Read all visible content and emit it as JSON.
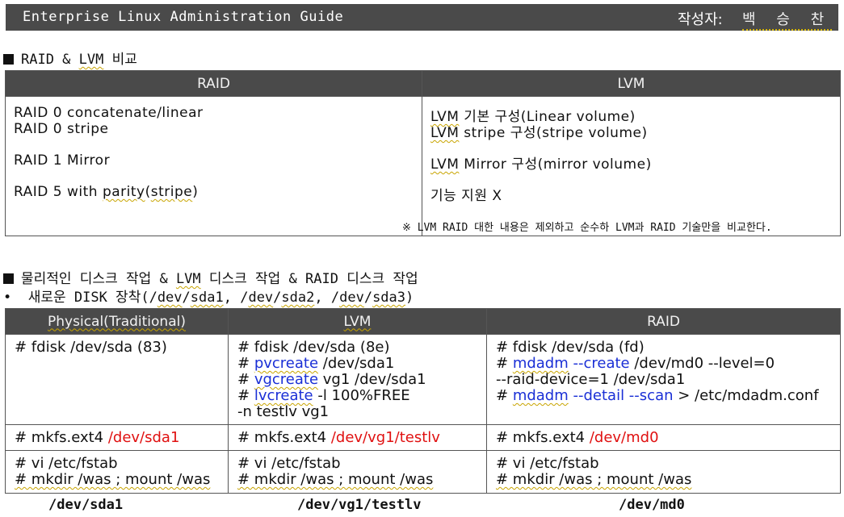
{
  "header": {
    "title": "Enterprise Linux Administration Guide",
    "author_label": "작성자:",
    "author_name": "백 승 찬"
  },
  "section1": {
    "title_pre": "RAID & ",
    "title_lvm": "LVM",
    "title_post": " 비교",
    "table": {
      "headers": [
        "RAID",
        "LVM"
      ],
      "raid": {
        "r0a": "RAID 0 concatenate/linear",
        "r0b": "RAID 0 stripe",
        "r1": "RAID 1 Mirror",
        "r5_pre": "RAID 5 with ",
        "r5_parity": "parity",
        "r5_paren_open": "(",
        "r5_stripe": "stripe",
        "r5_paren_close": ")"
      },
      "lvm": {
        "prefix": "LVM",
        "l1": " 기본 구성(Linear volume)",
        "l2": " stripe 구성(stripe volume)",
        "l3": " Mirror 구성(mirror volume)",
        "l4": "기능 지원 X"
      }
    },
    "note": "※ LVM RAID 대한 내용은 제외하고 순수하 LVM과 RAID 기술만을 비교한다."
  },
  "section2": {
    "title_pre": "물리적인 디스크 작업 & ",
    "title_lvm": "LVM",
    "title_post": " 디스크 작업 & RAID 디스크 작업",
    "bullet": {
      "pre": "새로운 DISK 장착(/",
      "dev1": "dev",
      "sda1": "sda1",
      "mid1": ", /",
      "dev2": "dev",
      "sda2": "sda2",
      "mid2": ", /",
      "dev3": "dev",
      "sda3": "sda3",
      "close": ")"
    },
    "table": {
      "headers": [
        "Physical(Traditional)",
        "LVM",
        "RAID"
      ],
      "row1": {
        "physical": "# fdisk /dev/sda (83)",
        "lvm": {
          "l1": "# fdisk /dev/sda (8e)",
          "l2_hash": "# ",
          "l2_cmd": "pvcreate",
          "l2_rest": " /dev/sda1",
          "l3_hash": "# ",
          "l3_cmd": "vgcreate",
          "l3_rest": " vg1 /dev/sda1",
          "l4_hash": "# ",
          "l4_cmd": "lvcreate",
          "l4_rest": " -l 100%FREE",
          "l5": "-n testlv vg1"
        },
        "raid": {
          "l1": "# fdisk /dev/sda (fd)",
          "l2_hash": "# ",
          "l2_cmd": "mdadm",
          "l2_opt": " --create",
          "l2_rest": " /dev/md0 --level=0",
          "l3": "--raid-device=1 /dev/sda1",
          "l4_hash": "# ",
          "l4_cmd": "mdadm",
          "l4_opt1": " --detail",
          "l4_opt2": " --scan",
          "l4_rest": " > /etc/mdadm.conf"
        }
      },
      "row2": {
        "cmd": "# mkfs.ext4 ",
        "physical_dev": "/dev/sda1",
        "lvm_dev": "/dev/vg1/testlv",
        "raid_dev": "/dev/md0"
      },
      "row3": {
        "l1": "# vi /etc/fstab",
        "l2": "# mkdir /was ; mount /was"
      }
    },
    "footer": [
      "/dev/sda1",
      "/dev/vg1/testlv",
      "/dev/md0"
    ]
  },
  "colors": {
    "header_bg": "#4a4a4a",
    "blue": "#1a2fd6",
    "red": "#e01010"
  }
}
